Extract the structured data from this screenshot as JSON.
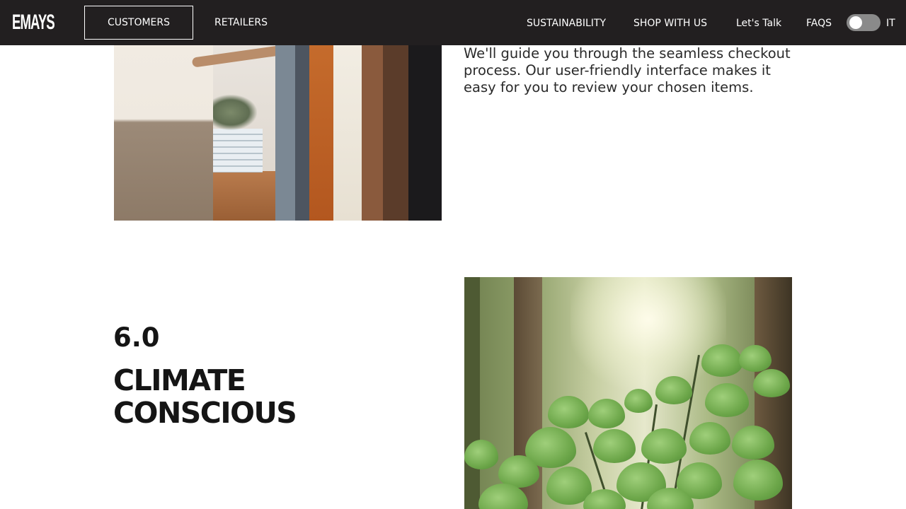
{
  "nav": {
    "logo": "EMAYS",
    "customers": "CUSTOMERS",
    "retailers": "RETAILERS",
    "sustainability": "SUSTAINABILITY",
    "shop_with_us": "SHOP WITH US",
    "lets_talk": "Let's Talk",
    "faqs": "FAQS",
    "language_label": "IT"
  },
  "step_5": {
    "text": "We'll guide you through the seamless checkout process. Our user-friendly interface makes it easy for you to review your chosen items."
  },
  "step_6": {
    "number": "6.0",
    "title": "CLIMATE CONSCIOUS"
  },
  "colors": {
    "navbar_bg": "#221f20",
    "nav_text": "#ffffff",
    "heading": "#151515",
    "toggle_track": "#8a8a8a"
  }
}
